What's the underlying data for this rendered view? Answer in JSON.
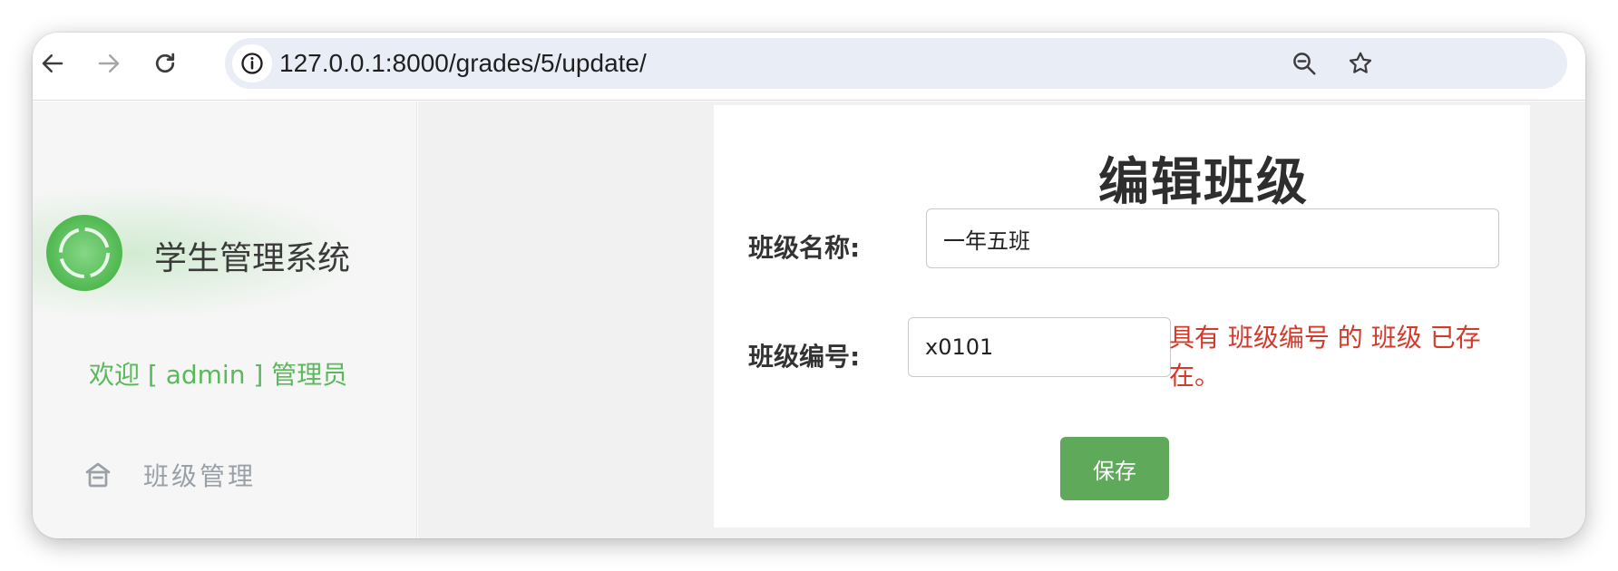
{
  "browser": {
    "url": "127.0.0.1:8000/grades/5/update/"
  },
  "sidebar": {
    "brand_title": "学生管理系统",
    "welcome": "欢迎 [ admin ] 管理员",
    "menu": [
      {
        "label": "班级管理",
        "icon": "house-icon"
      }
    ]
  },
  "form": {
    "title": "编辑班级",
    "name_label": "班级名称:",
    "name_value": "一年五班",
    "code_label": "班级编号:",
    "code_value": "x0101",
    "code_error": "具有 班级编号 的 班级 已存在。",
    "save_label": "保存"
  },
  "colors": {
    "accent_green": "#5fa95a",
    "welcome_green": "#5cb85c",
    "error_red": "#d43a2a",
    "omnibox_bg": "#e9eef6"
  }
}
